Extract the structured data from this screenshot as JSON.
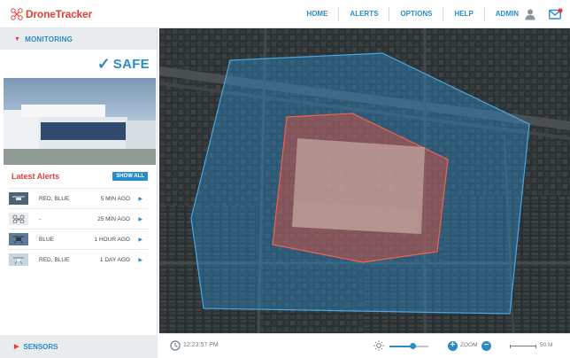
{
  "app": {
    "logo_text": "DroneTracker"
  },
  "nav": {
    "items": [
      "HOME",
      "ALERTS",
      "OPTIONS",
      "HELP",
      "ADMIN"
    ]
  },
  "sidebar": {
    "monitoring_label": "MONITORING",
    "status_text": "SAFE",
    "alerts_title": "Latest Alerts",
    "show_all_label": "SHOW ALL",
    "alerts": [
      {
        "label": "RED, BLUE",
        "time": "5 MIN AGO"
      },
      {
        "label": "-",
        "time": "25 MIN AGO"
      },
      {
        "label": "BLUE",
        "time": "1 HOUR AGO"
      },
      {
        "label": "RED, BLUE",
        "time": "1 DAY AGO"
      }
    ],
    "sensors_label": "SENSORS"
  },
  "bottom": {
    "time": "12:23:57 PM",
    "zoom_label": "ZOOM",
    "scale_label": "50 M",
    "brightness_level": 0.6
  },
  "colors": {
    "accent": "#2b8bc6",
    "alert": "#e0403a",
    "outer_zone": "#2d8fd0",
    "inner_zone": "#e0503f"
  }
}
